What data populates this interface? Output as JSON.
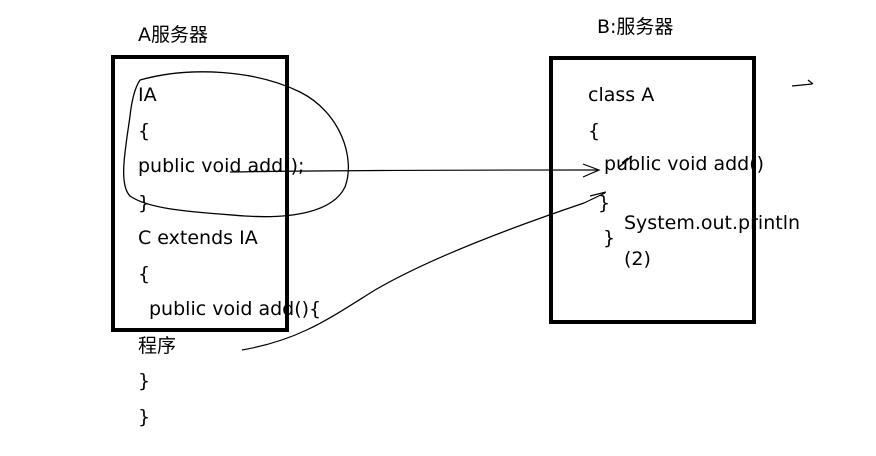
{
  "server_a": {
    "title": "A服务器",
    "lines": [
      "IA",
      "{",
      "public void add();",
      "}",
      "C extends IA",
      "{",
      "public void add(){",
      "程序",
      "}",
      "}"
    ]
  },
  "server_b": {
    "title": "B:服务器",
    "lines": [
      "class A",
      "{",
      "public void add()",
      "}",
      "}"
    ],
    "body_lines": [
      "System.out.println",
      "(2)"
    ]
  }
}
